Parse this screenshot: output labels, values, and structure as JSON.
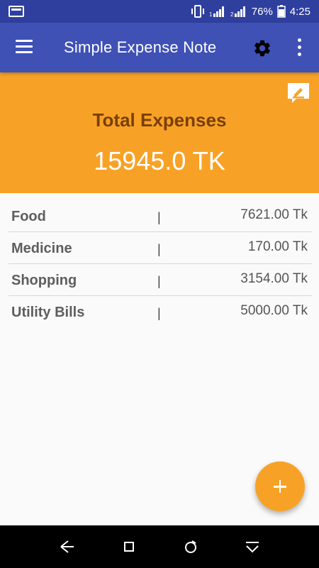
{
  "status_bar": {
    "battery_percent": "76%",
    "time": "4:25",
    "icons": [
      "notification-icon",
      "vibrate-icon",
      "signal-1-icon",
      "signal-2-icon",
      "battery-icon"
    ]
  },
  "app_bar": {
    "title": "Simple Expense Note",
    "icons": [
      "menu-icon",
      "gear-icon",
      "more-vert-icon"
    ]
  },
  "summary": {
    "label": "Total Expenses",
    "total": "15945.0 TK",
    "edit_icon": "edit-note-icon"
  },
  "expenses": [
    {
      "category": "Food",
      "separator": "|",
      "amount": "7621.00 Tk"
    },
    {
      "category": "Medicine",
      "separator": "|",
      "amount": "170.00 Tk"
    },
    {
      "category": "Shopping",
      "separator": "|",
      "amount": "3154.00 Tk"
    },
    {
      "category": "Utility Bills",
      "separator": "|",
      "amount": "5000.00 Tk"
    }
  ],
  "fab": {
    "icon": "plus-icon"
  },
  "nav_bar": {
    "icons": [
      "back-icon",
      "home-icon",
      "recents-icon",
      "hide-nav-icon"
    ]
  },
  "colors": {
    "primary": "#3f51b5",
    "status_bar": "#2f3f9e",
    "accent": "#f7a226",
    "total_label": "#7a3f07"
  }
}
